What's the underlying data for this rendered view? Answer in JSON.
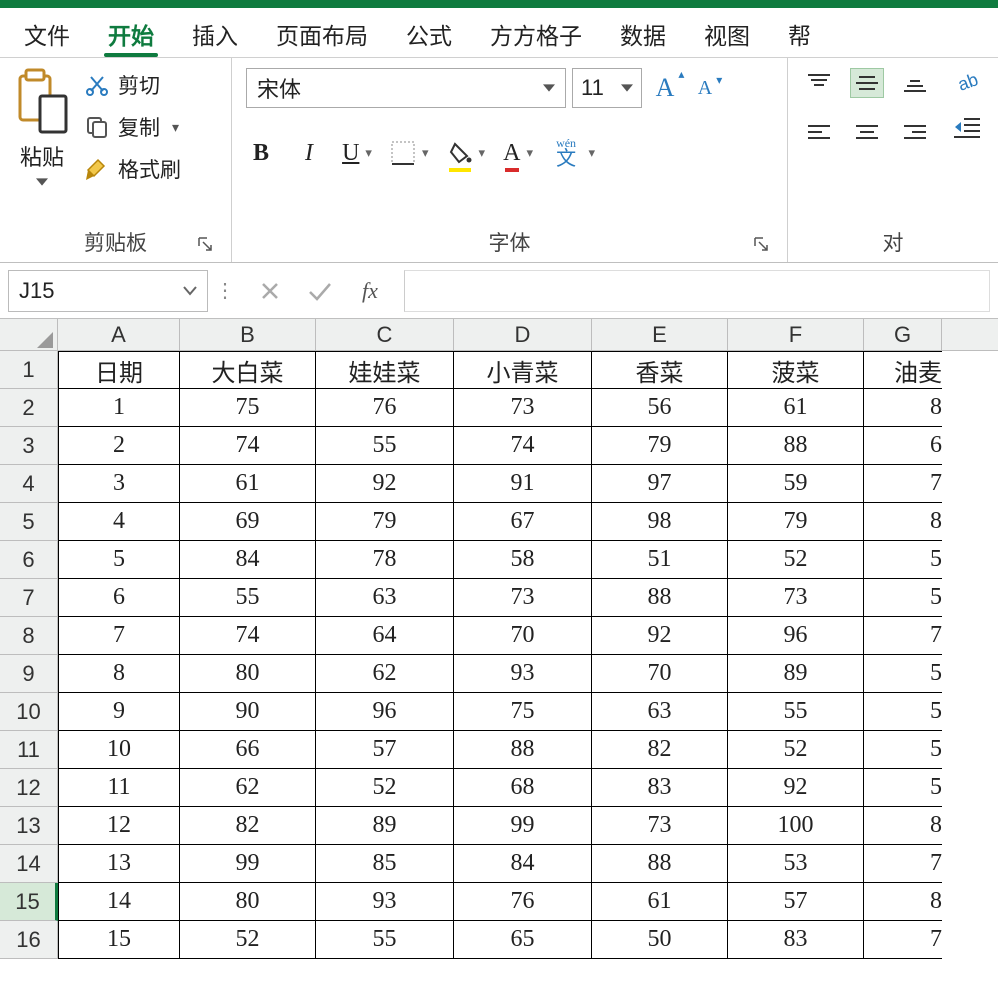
{
  "menu": {
    "items": [
      "文件",
      "开始",
      "插入",
      "页面布局",
      "公式",
      "方方格子",
      "数据",
      "视图",
      "帮"
    ],
    "activeIndex": 1
  },
  "ribbon": {
    "clipboard": {
      "paste": "粘贴",
      "cut": "剪切",
      "copy": "复制",
      "formatPainter": "格式刷",
      "group": "剪贴板"
    },
    "font": {
      "name": "宋体",
      "size": "11",
      "increaseHint": "A",
      "decreaseHint": "A",
      "bold": "B",
      "italic": "I",
      "underline": "U",
      "pinyin": "wén",
      "pinyinChar": "文",
      "group": "字体"
    },
    "align": {
      "group": "对"
    }
  },
  "formulaBar": {
    "nameBox": "J15",
    "fx": "fx"
  },
  "sheet": {
    "cols": [
      "A",
      "B",
      "C",
      "D",
      "E",
      "F",
      "G"
    ],
    "widths": [
      "wA",
      "wB",
      "wC",
      "wD",
      "wE",
      "wF",
      "wG"
    ],
    "rowHeaders": [
      "1",
      "2",
      "3",
      "4",
      "5",
      "6",
      "7",
      "8",
      "9",
      "10",
      "11",
      "12",
      "13",
      "14",
      "15",
      "16"
    ],
    "selectedRowIndex": 14,
    "data": [
      [
        "日期",
        "大白菜",
        "娃娃菜",
        "小青菜",
        "香菜",
        "菠菜",
        "油麦"
      ],
      [
        "1",
        "75",
        "76",
        "73",
        "56",
        "61",
        "8"
      ],
      [
        "2",
        "74",
        "55",
        "74",
        "79",
        "88",
        "6"
      ],
      [
        "3",
        "61",
        "92",
        "91",
        "97",
        "59",
        "7"
      ],
      [
        "4",
        "69",
        "79",
        "67",
        "98",
        "79",
        "8"
      ],
      [
        "5",
        "84",
        "78",
        "58",
        "51",
        "52",
        "5"
      ],
      [
        "6",
        "55",
        "63",
        "73",
        "88",
        "73",
        "5"
      ],
      [
        "7",
        "74",
        "64",
        "70",
        "92",
        "96",
        "7"
      ],
      [
        "8",
        "80",
        "62",
        "93",
        "70",
        "89",
        "5"
      ],
      [
        "9",
        "90",
        "96",
        "75",
        "63",
        "55",
        "5"
      ],
      [
        "10",
        "66",
        "57",
        "88",
        "82",
        "52",
        "5"
      ],
      [
        "11",
        "62",
        "52",
        "68",
        "83",
        "92",
        "5"
      ],
      [
        "12",
        "82",
        "89",
        "99",
        "73",
        "100",
        "8"
      ],
      [
        "13",
        "99",
        "85",
        "84",
        "88",
        "53",
        "7"
      ],
      [
        "14",
        "80",
        "93",
        "76",
        "61",
        "57",
        "8"
      ],
      [
        "15",
        "52",
        "55",
        "65",
        "50",
        "83",
        "7"
      ]
    ]
  }
}
